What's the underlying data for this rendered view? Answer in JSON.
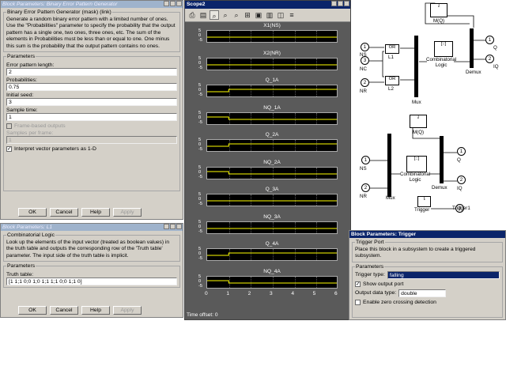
{
  "bep_dialog": {
    "title": "Block Parameters: Binary Error Pattern Generator",
    "mask_legend": "Binary Error Pattern Generator (mask) (link)",
    "description": "Generate a random binary error pattern with a limited number of ones. Use the \"Probabilities\" parameter to specify the probability that the output pattern has a single one, two ones, three ones, etc. The sum of the elements in Probabilities must be less than or equal to one. One minus this sum is the probability that the output pattern contains no ones.",
    "params_legend": "Parameters",
    "err_len_label": "Error pattern length:",
    "err_len_value": "2",
    "prob_label": "Probabilities:",
    "prob_value": "0.75",
    "seed_label": "Initial seed:",
    "seed_value": "3",
    "sample_label": "Sample time:",
    "sample_value": "1",
    "frame_label": "Frame-based outputs",
    "spf_label": "Samples per frame:",
    "spf_value": "1",
    "interp_label": "Interpret vector parameters as 1-D",
    "ok": "OK",
    "cancel": "Cancel",
    "help": "Help",
    "apply": "Apply"
  },
  "cl_dialog": {
    "title": "Block Parameters: L1",
    "legend": "Combinatorial Logic",
    "description": "Look up the elements of the input vector (treated as boolean values) in the truth table and outputs the corresponding row of the 'Truth table' parameter.  The input side of the truth table is implicit.",
    "params_legend": "Parameters",
    "tt_label": "Truth table:",
    "tt_value": "[1 1;1 0;0 1;0 1;1 1;1 0;0 1;1 0]",
    "ok": "OK",
    "cancel": "Cancel",
    "help": "Help",
    "apply": "Apply"
  },
  "scope": {
    "title": "Scope2",
    "time_offset": "Time offset:  0",
    "plots": [
      {
        "title": "X1(NS)",
        "trace": [
          [
            0,
            0
          ],
          [
            6,
            0
          ]
        ]
      },
      {
        "title": "X2(NR)",
        "trace": [
          [
            0,
            0
          ],
          [
            6,
            0
          ]
        ]
      },
      {
        "title": "Q_1A",
        "trace": [
          [
            0,
            0
          ],
          [
            1,
            0
          ],
          [
            1,
            1
          ],
          [
            6,
            1
          ]
        ]
      },
      {
        "title": "NQ_1A",
        "trace": [
          [
            0,
            1
          ],
          [
            1,
            1
          ],
          [
            1,
            0
          ],
          [
            6,
            0
          ]
        ]
      },
      {
        "title": "Q_2A",
        "trace": [
          [
            0,
            0
          ],
          [
            1,
            0
          ],
          [
            1,
            1
          ],
          [
            6,
            1
          ]
        ]
      },
      {
        "title": "NQ_2A",
        "trace": [
          [
            0,
            1
          ],
          [
            1,
            1
          ],
          [
            1,
            0
          ],
          [
            6,
            0
          ]
        ]
      },
      {
        "title": "Q_3A",
        "trace": [
          [
            0,
            0
          ],
          [
            6,
            0
          ]
        ]
      },
      {
        "title": "NQ_3A",
        "trace": [
          [
            0,
            0
          ],
          [
            6,
            0
          ]
        ]
      },
      {
        "title": "Q_4A",
        "trace": [
          [
            0,
            0
          ],
          [
            1,
            0
          ],
          [
            1,
            1
          ],
          [
            6,
            1
          ]
        ]
      },
      {
        "title": "NQ_4A",
        "trace": [
          [
            0,
            1
          ],
          [
            1,
            1
          ],
          [
            1,
            0
          ],
          [
            6,
            0
          ]
        ]
      }
    ],
    "yticks": [
      "5",
      "0",
      "-5"
    ],
    "xticks": [
      "0",
      "1",
      "2",
      "3",
      "4",
      "5",
      "6"
    ],
    "trace_color": "#ffff00"
  },
  "diagram": {
    "top": {
      "ns": "NS",
      "nc": "NC",
      "nr": "NR",
      "ns_num": "1",
      "nc_num": "3",
      "nr_num": "2",
      "or": "OR",
      "l1": "L1",
      "l2": "L2",
      "mq": "M(Q)",
      "cl": "Combinatorial\nLogic",
      "demux": "Demux",
      "mux": "Mux",
      "q": "Q",
      "iq": "IQ",
      "q_num": "1",
      "iq_num": "2"
    },
    "bottom": {
      "ns": "NS",
      "nr": "NR",
      "ns_num": "1",
      "nr_num": "2",
      "mq": "M(Q)",
      "cl": "Combinatorial\nLogic",
      "demux": "Demux",
      "mux": "Mux",
      "q": "Q",
      "iq": "IQ",
      "q_num": "1",
      "iq_num": "2",
      "trigger": "Trigger",
      "trigger1": "Trigger1",
      "trig_num": "3"
    }
  },
  "trig_dialog": {
    "title": "Block Parameters: Trigger",
    "legend": "Trigger Port",
    "description": "Place this block in a subsystem to create a triggered subsystem.",
    "params_legend": "Parameters",
    "type_label": "Trigger type:",
    "type_value": "falling",
    "show_port_label": "Show output port",
    "dtype_label": "Output data type:",
    "dtype_value": "double",
    "zc_label": "Enable zero crossing detection"
  }
}
